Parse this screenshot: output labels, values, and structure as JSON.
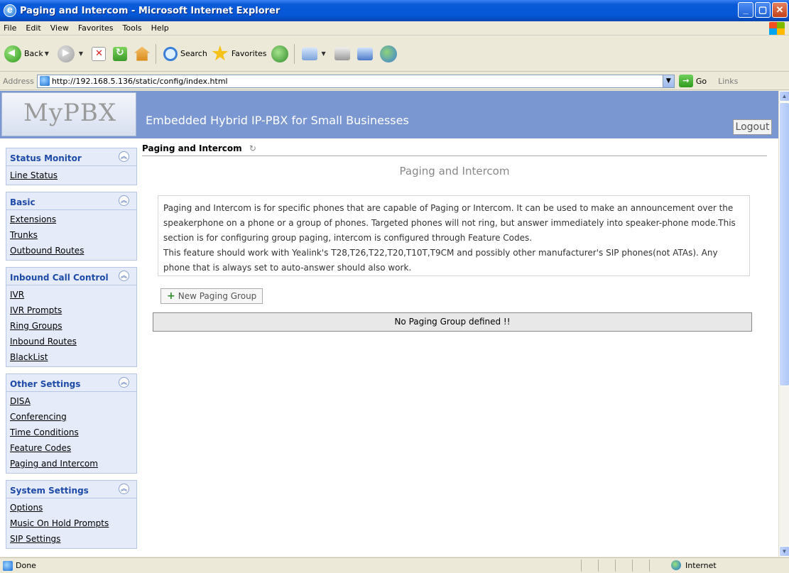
{
  "window": {
    "title": "Paging and Intercom - Microsoft Internet Explorer",
    "buttons": {
      "minimize": "_",
      "maximize": "▢",
      "close": "✕"
    }
  },
  "menu": [
    "File",
    "Edit",
    "View",
    "Favorites",
    "Tools",
    "Help"
  ],
  "toolbar": {
    "back_label": "Back",
    "search_label": "Search",
    "favorites_label": "Favorites"
  },
  "address": {
    "label": "Address",
    "url": "http://192.168.5.136/static/config/index.html",
    "go_label": "Go",
    "links_label": "Links"
  },
  "header": {
    "logo": "MyPBX",
    "tagline": "Embedded Hybrid IP-PBX for Small Businesses",
    "logout_label": "Logout"
  },
  "sidebar": {
    "groups": [
      {
        "title": "Status Monitor",
        "items": [
          "Line Status"
        ]
      },
      {
        "title": "Basic",
        "items": [
          "Extensions",
          "Trunks",
          "Outbound Routes"
        ]
      },
      {
        "title": "Inbound Call Control",
        "items": [
          "IVR",
          "IVR Prompts",
          "Ring Groups",
          "Inbound Routes",
          "BlackList"
        ]
      },
      {
        "title": "Other Settings",
        "items": [
          "DISA",
          "Conferencing",
          "Time Conditions",
          "Feature Codes",
          "Paging and Intercom"
        ]
      },
      {
        "title": "System Settings",
        "items": [
          "Options",
          "Music On Hold Prompts",
          "SIP Settings"
        ]
      }
    ]
  },
  "main": {
    "pane_title": "Paging and Intercom",
    "heading": "Paging and Intercom",
    "description_line1": "Paging and Intercom is for specific phones that are capable of Paging or Intercom. It can be used to make an announcement over the speakerphone on a phone or a group of phones. Targeted phones will not ring, but answer immediately into speaker-phone mode.This section is for configuring group paging, intercom is configured through Feature Codes.",
    "description_line2": "This feature should work with Yealink's T28,T26,T22,T20,T10T,T9CM and possibly other manufacturer's SIP phones(not ATAs). Any phone that is always set to auto-answer should also work.",
    "new_button_label": "New Paging Group",
    "empty_message": "No Paging Group defined !!"
  },
  "status": {
    "text": "Done",
    "zone": "Internet"
  }
}
